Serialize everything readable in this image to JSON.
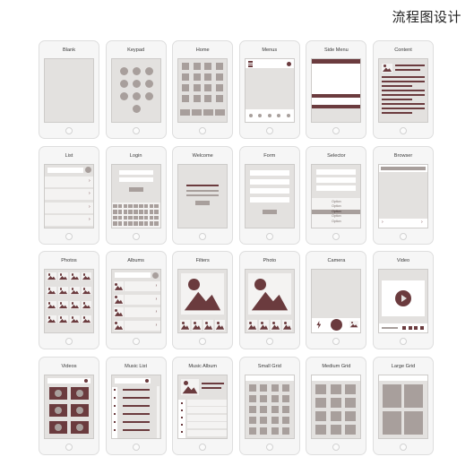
{
  "page": {
    "title": "流程图设计"
  },
  "screens": [
    {
      "label": "Blank"
    },
    {
      "label": "Keypad"
    },
    {
      "label": "Home"
    },
    {
      "label": "Menus"
    },
    {
      "label": "Side Menu"
    },
    {
      "label": "Content"
    },
    {
      "label": "List"
    },
    {
      "label": "Login"
    },
    {
      "label": "Welcome"
    },
    {
      "label": "Form"
    },
    {
      "label": "Selector"
    },
    {
      "label": "Browser"
    },
    {
      "label": "Photos"
    },
    {
      "label": "Albums"
    },
    {
      "label": "Filters"
    },
    {
      "label": "Photo"
    },
    {
      "label": "Camera"
    },
    {
      "label": "Video"
    },
    {
      "label": "Videos"
    },
    {
      "label": "Music List"
    },
    {
      "label": "Music Album"
    },
    {
      "label": "Small Grid"
    },
    {
      "label": "Medium Grid"
    },
    {
      "label": "Large Grid"
    }
  ],
  "selector_options": [
    "Option",
    "Option",
    "Option",
    "Option",
    "Option"
  ],
  "colors": {
    "accent": "#6b3b3e",
    "placeholder": "#a89f9c",
    "screen": "#e3e1df"
  }
}
